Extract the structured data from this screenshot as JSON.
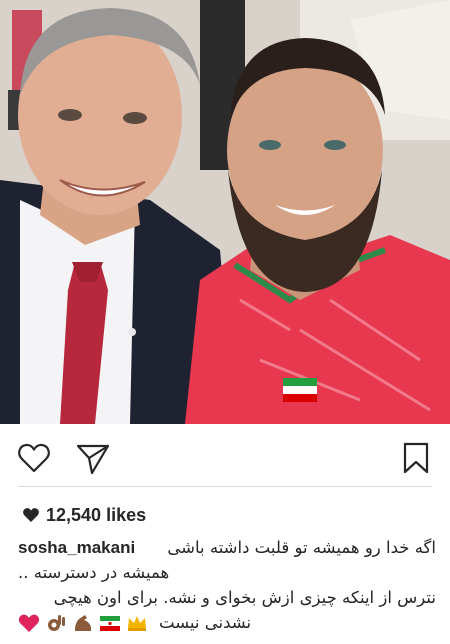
{
  "post": {
    "username": "sosha_makani",
    "likes_count": "12,540",
    "likes_word": "likes",
    "caption_lines": [
      "اگه خدا رو همیشه تو قلبت داشته باشی",
      "همیشه در دسترسته ..",
      "نترس از اینکه چیزی ازش بخوای و نشه. برای اون هیچی",
      "نشدنی نیست"
    ],
    "caption_emojis": [
      "red-heart",
      "ok-hand-dark",
      "flexed-biceps-dark",
      "flag-iran",
      "crown"
    ]
  },
  "actions": {
    "like_icon": "heart-outline-icon",
    "share_icon": "paper-plane-icon",
    "save_icon": "bookmark-icon"
  },
  "colors": {
    "text": "#262626",
    "divider": "#dbdbdb",
    "jersey_red": "#e8384f"
  }
}
